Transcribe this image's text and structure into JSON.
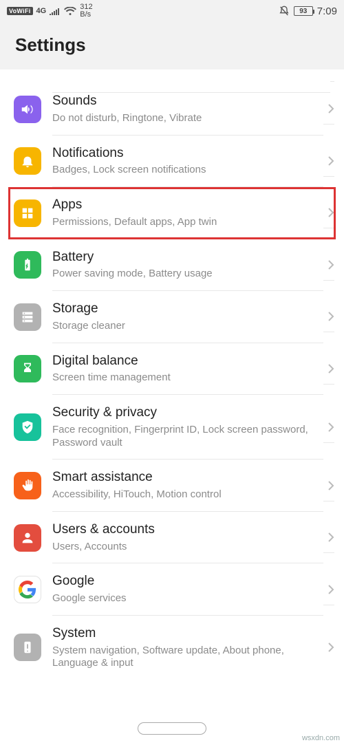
{
  "status": {
    "vowifi": "VoWiFi",
    "net": "4G",
    "speed_top": "312",
    "speed_bot": "B/s",
    "battery": "93",
    "time": "7:09"
  },
  "header": {
    "title": "Settings"
  },
  "rows": [
    {
      "title": "Sounds",
      "sub": "Do not disturb, Ringtone, Vibrate"
    },
    {
      "title": "Notifications",
      "sub": "Badges, Lock screen notifications"
    },
    {
      "title": "Apps",
      "sub": "Permissions, Default apps, App twin"
    },
    {
      "title": "Battery",
      "sub": "Power saving mode, Battery usage"
    },
    {
      "title": "Storage",
      "sub": "Storage cleaner"
    },
    {
      "title": "Digital balance",
      "sub": "Screen time management"
    },
    {
      "title": "Security & privacy",
      "sub": "Face recognition, Fingerprint ID, Lock screen password, Password vault"
    },
    {
      "title": "Smart assistance",
      "sub": "Accessibility, HiTouch, Motion control"
    },
    {
      "title": "Users & accounts",
      "sub": "Users, Accounts"
    },
    {
      "title": "Google",
      "sub": "Google services"
    },
    {
      "title": "System",
      "sub": "System navigation, Software update, About phone, Language & input"
    }
  ],
  "watermark": "wsxdn.com"
}
